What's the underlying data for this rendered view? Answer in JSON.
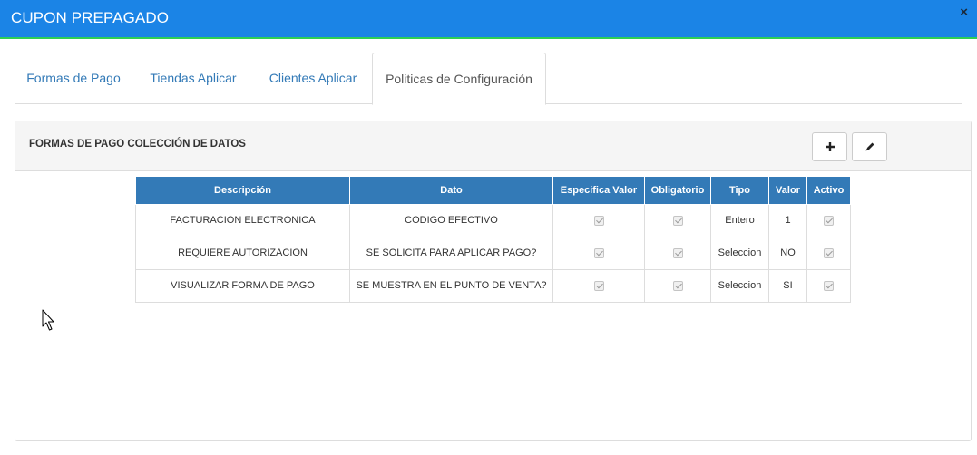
{
  "modal": {
    "title": "CUPON PREPAGADO",
    "close_glyph": "×"
  },
  "tabs": [
    {
      "label": "Formas de Pago",
      "active": false
    },
    {
      "label": "Tiendas Aplicar",
      "active": false
    },
    {
      "label": "Clientes Aplicar",
      "active": false
    },
    {
      "label": "Politicas de Configuración",
      "active": true
    }
  ],
  "panel": {
    "title": "FORMAS DE PAGO COLECCIÓN DE DATOS",
    "add_icon": "plus-icon",
    "edit_icon": "pencil-icon"
  },
  "table": {
    "columns": [
      "Descripción",
      "Dato",
      "Especifica Valor",
      "Obligatorio",
      "Tipo",
      "Valor",
      "Activo"
    ],
    "rows": [
      {
        "descripcion": "FACTURACION ELECTRONICA",
        "dato": "CODIGO EFECTIVO",
        "especifica_valor": true,
        "obligatorio": true,
        "tipo": "Entero",
        "valor": "1",
        "activo": true
      },
      {
        "descripcion": "REQUIERE AUTORIZACION",
        "dato": "SE SOLICITA PARA APLICAR PAGO?",
        "especifica_valor": true,
        "obligatorio": true,
        "tipo": "Seleccion",
        "valor": "NO",
        "activo": true
      },
      {
        "descripcion": "VISUALIZAR FORMA DE PAGO",
        "dato": "SE MUESTRA EN EL PUNTO DE VENTA?",
        "especifica_valor": true,
        "obligatorio": true,
        "tipo": "Seleccion",
        "valor": "SI",
        "activo": true
      }
    ]
  },
  "colors": {
    "header_bg": "#1b84e6",
    "header_accent": "#2fcf54",
    "table_header_bg": "#337ab7",
    "tab_link": "#337ab7"
  },
  "cursor_icon": "mouse-pointer-icon"
}
